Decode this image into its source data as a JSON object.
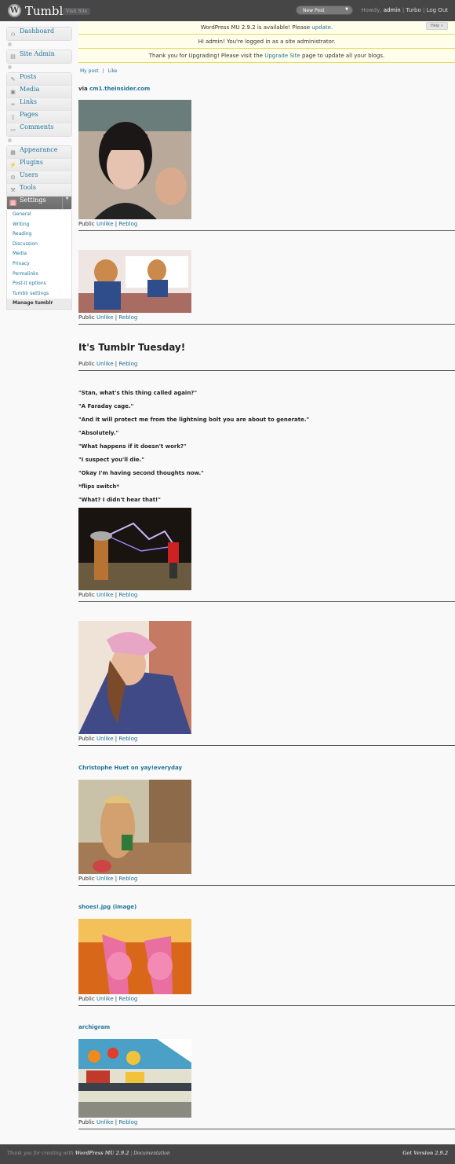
{
  "header": {
    "site_title": "Tumblr",
    "visit_site": "Visit Site",
    "new_post": "New Post",
    "howdy": "Howdy,",
    "user": "admin",
    "turbo": "Turbo",
    "log_out": "Log Out",
    "sep": "|"
  },
  "sidebar": {
    "dashboard": "Dashboard",
    "site_admin": "Site Admin",
    "posts": "Posts",
    "media": "Media",
    "links": "Links",
    "pages": "Pages",
    "comments": "Comments",
    "appearance": "Appearance",
    "plugins": "Plugins",
    "users": "Users",
    "tools": "Tools",
    "settings": "Settings",
    "settings_sub": [
      "General",
      "Writing",
      "Reading",
      "Discussion",
      "Media",
      "Privacy",
      "Permalinks",
      "Post-it options",
      "Tumblr settings",
      "Manage tumblr"
    ]
  },
  "notices": {
    "update_prefix": "WordPress MU 2.9.2 is available! Please ",
    "update_link": "update",
    "update_suffix": ".",
    "admin": "Hi admin! You're logged in as a site administrator.",
    "upgrade_prefix": "Thank you for Upgrading! Please visit the ",
    "upgrade_link": "Upgrade Site",
    "upgrade_suffix": " page to update all your blogs.",
    "help": "Help »"
  },
  "subnav": {
    "my_post": "My post",
    "sep": "|",
    "like": "Like"
  },
  "meta": {
    "public": "Public",
    "unlike": "Unlike",
    "reblog": "Reblog",
    "sep": "|"
  },
  "posts": {
    "p1_via": "via",
    "p1_link": "cm1.theinsider.com",
    "p3_title": "It's Tumblr Tuesday!",
    "quotes": [
      "\"Stan, what's this thing called again?\"",
      "\"A Faraday cage.\"",
      "\"And it will protect me from the lightning bolt you are about to generate.\"",
      "\"Absolutely.\"",
      "\"What happens if it doesn't work?\"",
      "\"I suspect you'll die.\"",
      "\"Okay I'm having second thoughts now.\"",
      "*flips switch*",
      "\"What? I didn't hear that!\""
    ],
    "p6_link": "Christophe Huet on yay!everyday",
    "p7_link": "shoes!.jpg (image)",
    "p8_link": "archigram"
  },
  "footer": {
    "thanks": "Thank you for creating with ",
    "wp": "WordPress MU 2.9.2",
    "sep": " | ",
    "docs": "Documentation",
    "version": "Get Version 2.9.2"
  }
}
